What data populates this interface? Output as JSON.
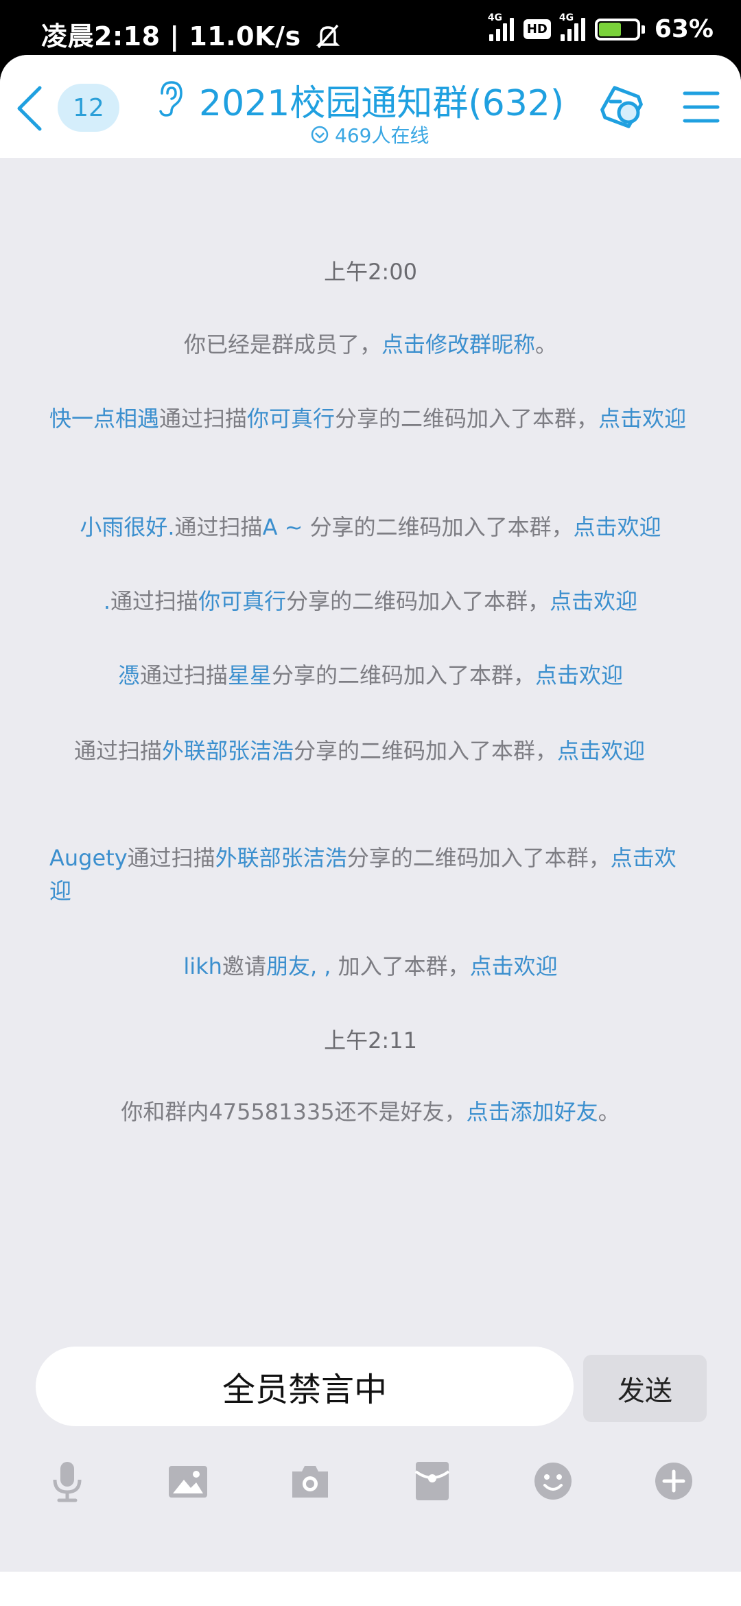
{
  "status": {
    "time_text": "凌晨2:18 | 11.0K/s",
    "net_tag_1": "4G",
    "hd": "HD",
    "net_tag_2": "4G",
    "battery_percent": "63%",
    "battery_level": 63
  },
  "header": {
    "unread_count": "12",
    "title": "2021校园通知群(632)",
    "online_text": "469人在线"
  },
  "messages": {
    "m1_time": "上午2:00",
    "m2_text": "你已经是群成员了，",
    "m2_link": "点击修改群昵称",
    "m2_end": "。",
    "m3_user": "快一点相遇",
    "m3_mid": "通过扫描",
    "m3_sharer": "你可真行",
    "m3_text": "分享的二维码加入了本群，",
    "m3_link": "点击欢迎",
    "m4_user": "小雨很好.",
    "m4_mid": "通过扫描",
    "m4_sharer": "A ~",
    "m4_text": " 分享的二维码加入了本群，",
    "m4_link": "点击欢迎",
    "m5_user": ".",
    "m5_mid": "通过扫描",
    "m5_sharer": "你可真行",
    "m5_text": "分享的二维码加入了本群，",
    "m5_link": "点击欢迎",
    "m6_user": "憑",
    "m6_mid": "通过扫描",
    "m6_sharer": "星星",
    "m6_text": "分享的二维码加入了本群，",
    "m6_link": "点击欢迎",
    "m7_user": "",
    "m7_mid": "通过扫描",
    "m7_sharer": "外联部张洁浩",
    "m7_text": "分享的二维码加入了本群，",
    "m7_link": "点击欢迎",
    "m8_user": "Augety",
    "m8_mid": "通过扫描",
    "m8_sharer": "外联部张洁浩",
    "m8_text": "分享的二维码加入了本群，",
    "m8_link": "点击欢迎",
    "m9_user": "likh",
    "m9_mid": "邀请",
    "m9_friend": "朋友, ,",
    "m9_text": " 加入了本群，",
    "m9_link": "点击欢迎",
    "m10_time": "上午2:11",
    "m11_text": "你和群内475581335还不是好友，",
    "m11_link": "点击添加好友",
    "m11_end": "。"
  },
  "input": {
    "muted_text": "全员禁言中",
    "send_label": "发送"
  },
  "colors": {
    "accent": "#1fa0e0",
    "link": "#3b8fce",
    "system_text": "#7d7d83",
    "background": "#ebebf0"
  },
  "icons": {
    "toolbar": [
      "microphone-icon",
      "image-icon",
      "camera-icon",
      "red-packet-icon",
      "emoji-icon",
      "plus-icon"
    ],
    "nav": [
      "menu-lines-icon",
      "home-square-icon",
      "back-chevron-icon"
    ]
  }
}
